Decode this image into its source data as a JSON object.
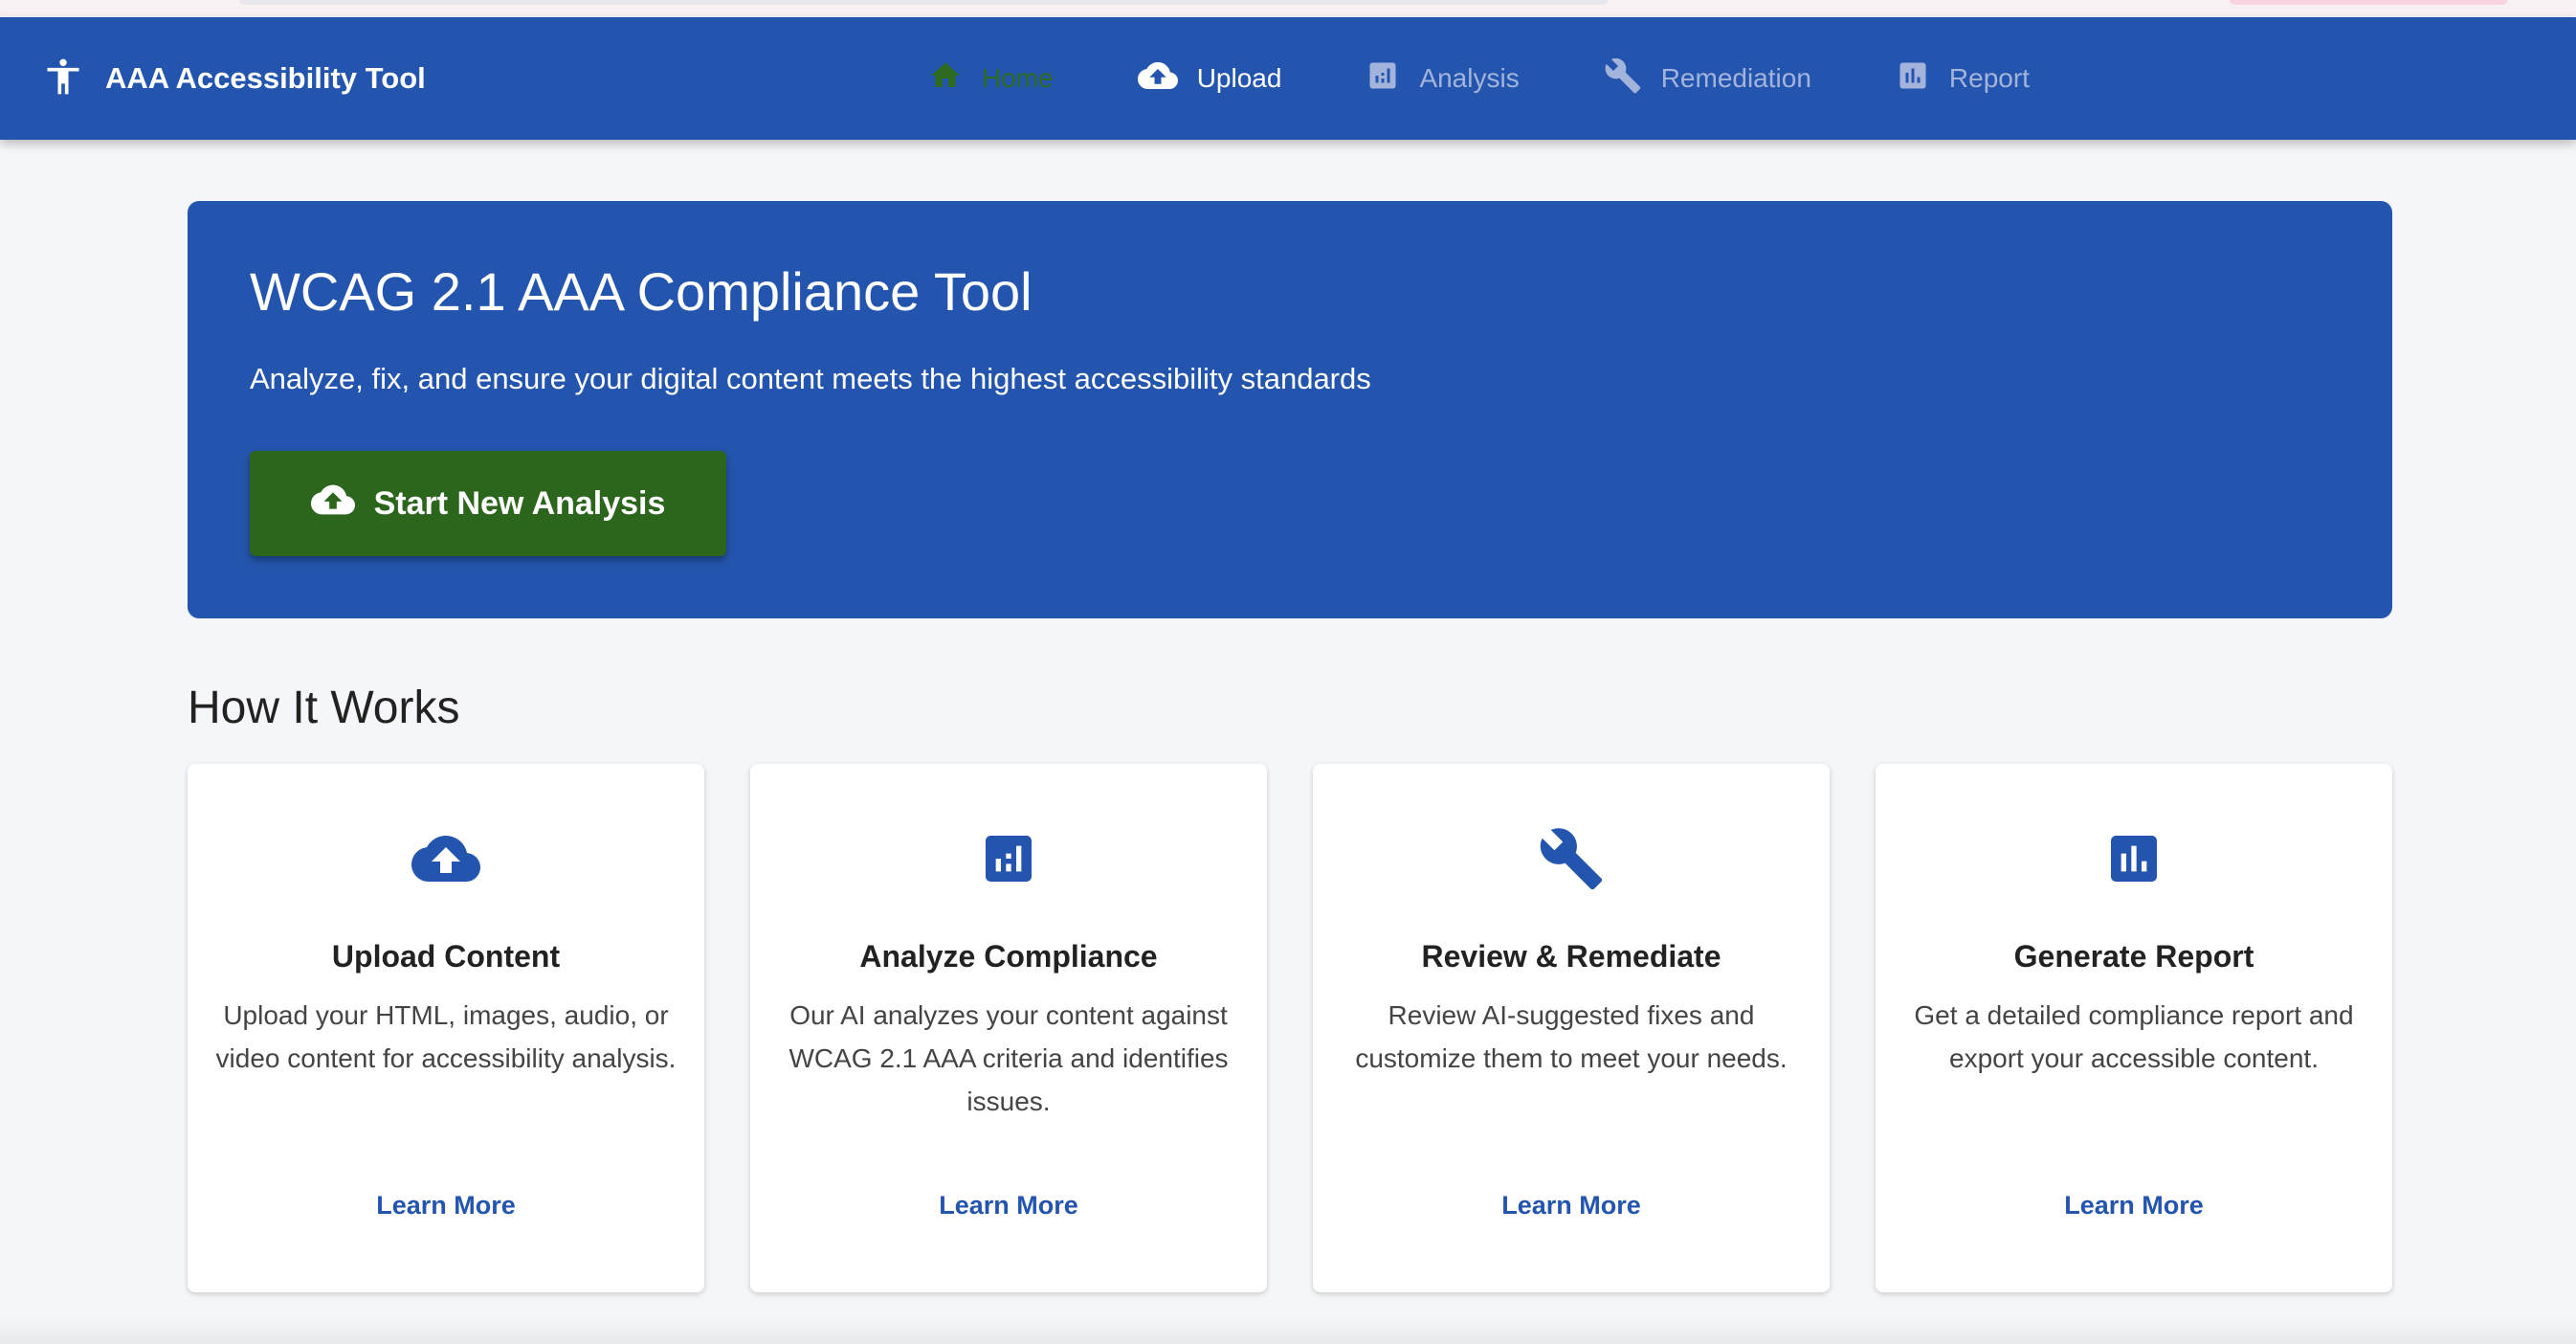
{
  "app": {
    "title": "AAA Accessibility Tool"
  },
  "nav": {
    "items": [
      {
        "label": "Home",
        "icon": "home-icon",
        "state": "active"
      },
      {
        "label": "Upload",
        "icon": "cloud-upload-icon",
        "state": "enabled"
      },
      {
        "label": "Analysis",
        "icon": "analytics-icon",
        "state": "disabled"
      },
      {
        "label": "Remediation",
        "icon": "wrench-icon",
        "state": "disabled"
      },
      {
        "label": "Report",
        "icon": "bar-chart-icon",
        "state": "disabled"
      }
    ]
  },
  "hero": {
    "title": "WCAG 2.1 AAA Compliance Tool",
    "subtitle": "Analyze, fix, and ensure your digital content meets the highest accessibility standards",
    "cta_label": "Start New Analysis"
  },
  "how_it_works": {
    "title": "How It Works",
    "cards": [
      {
        "icon": "cloud-upload-icon",
        "title": "Upload Content",
        "description": "Upload your HTML, images, audio, or video content for accessibility analysis.",
        "link": "Learn More"
      },
      {
        "icon": "analytics-icon",
        "title": "Analyze Compliance",
        "description": "Our AI analyzes your content against WCAG 2.1 AAA criteria and identifies issues.",
        "link": "Learn More"
      },
      {
        "icon": "wrench-icon",
        "title": "Review & Remediate",
        "description": "Review AI-suggested fixes and customize them to meet your needs.",
        "link": "Learn More"
      },
      {
        "icon": "bar-chart-icon",
        "title": "Generate Report",
        "description": "Get a detailed compliance report and export your accessible content.",
        "link": "Learn More"
      }
    ]
  },
  "colors": {
    "primary": "#2455ae",
    "success": "#2c651c",
    "background": "#f5f6f9",
    "nav_disabled": "#a3b4dc",
    "nav_active": "#2e6a1f"
  }
}
